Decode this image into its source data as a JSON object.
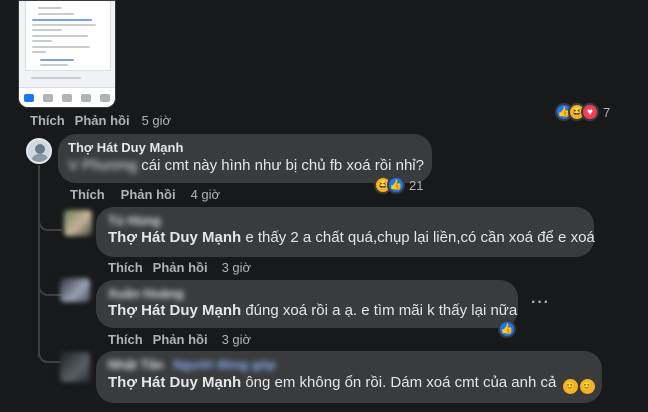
{
  "top_comment": {
    "reply_label": "Phản hồi",
    "like_label": "Thích",
    "time": "5 giờ",
    "reactions_count": "7"
  },
  "comments": [
    {
      "author": "Thợ Hát Duy Mạnh",
      "body_hidden": "V Phương",
      "body": "cái cmt này hình như bị chủ fb xoá rồi nhỉ?",
      "like_label": "Thích",
      "reply_label": "Phản hồi",
      "time": "4 giờ",
      "reactions_count": "21"
    },
    {
      "author_hidden": "Tú Hùng",
      "mention": "Thợ Hát Duy Mạnh",
      "body": "e thấy 2 a chất quá,chụp lại liền,có cần xoá để e xoá",
      "like_label": "Thích",
      "reply_label": "Phản hồi",
      "time": "3 giờ"
    },
    {
      "author_hidden": "Xuân Hoàng",
      "mention": "Thợ Hát Duy Mạnh",
      "body": "đúng xoá rồi a ạ. e tìm mãi k thấy lại nữa",
      "like_label": "Thích",
      "reply_label": "Phản hồi",
      "time": "3 giờ",
      "reactions_count": "1"
    },
    {
      "author_hidden": "Nhật Tân",
      "author_badge_hidden": "Người đóng góp",
      "mention": "Thợ Hát Duy Mạnh",
      "body": "ông em không ổn rồi. Dám xoá cmt của anh cả",
      "like_label": "Thích",
      "reply_label": "Phản hồi",
      "time": "3 giờ"
    }
  ],
  "more_icon": "more-horizontal-icon",
  "colors": {
    "background": "#18191a",
    "bubble": "#3a3b3c",
    "text": "#e4e6eb",
    "muted": "#b0b3b8",
    "like": "#1877f2",
    "love": "#f33e58",
    "haha": "#f7b125"
  }
}
